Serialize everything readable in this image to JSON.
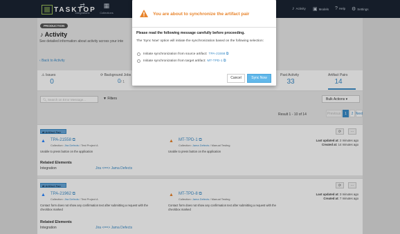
{
  "app": {
    "logo_text": "TASKTOP"
  },
  "nav": {
    "items": [
      {
        "label": "Integrations",
        "icon": "integrations-icon"
      },
      {
        "label": "Collections",
        "icon": "collections-icon"
      }
    ],
    "right": [
      {
        "label": "Activity",
        "icon": "bell-icon"
      },
      {
        "label": "Models",
        "icon": "models-icon"
      },
      {
        "label": "Help",
        "icon": "help-icon"
      },
      {
        "label": "Settings",
        "icon": "gear-icon"
      }
    ]
  },
  "page": {
    "badge": "PRODUCTION",
    "title": "Activity",
    "subtitle": "See detailed information about activity across your inte",
    "back_link": "Back to Activity"
  },
  "stats": [
    {
      "label": "Issues",
      "value": "0",
      "icon": "warning-icon"
    },
    {
      "label": "Background Jobs",
      "value": "0",
      "total": "/ 1",
      "icon": "jobs-icon"
    },
    {
      "label": "Past Activity",
      "value": "33"
    },
    {
      "label": "Artifact Pairs",
      "value": "14"
    }
  ],
  "toolbar": {
    "search_placeholder": "Search on Error Message...",
    "filters_label": "Filters",
    "bulk_actions_label": "Bulk Actions"
  },
  "pagination": {
    "result_text": "Result 1 - 10 of 14",
    "previous": "Previous",
    "page1": "1",
    "page2": "2",
    "next": "Next"
  },
  "cards": [
    {
      "tag": "Artifact Pair",
      "left": {
        "id": "TPA-21558",
        "collection_label": "Collection:",
        "collection": "Jira Defects",
        "project": "/ Test Project A",
        "desc": "Unable to press button on the application"
      },
      "right": {
        "id": "MT-TPD-1",
        "collection_label": "Collection:",
        "collection": "Jama Defects",
        "project": "/ Manual Testing",
        "desc": "Unable to press button on the application"
      },
      "updated_label": "Last updated at:",
      "updated": "2 minutes ago",
      "created_label": "Created at:",
      "created": "14 minutes ago",
      "related_title": "Related Elements",
      "integration_label": "Integration",
      "integration_value": "Jira <==> Jama Defects"
    },
    {
      "tag": "Artifact Pair",
      "left": {
        "id": "TPA-21962",
        "collection_label": "Collection:",
        "collection": "Jira Defects",
        "project": "/ Test Project A",
        "desc": "Contact form does not show any confirmation text after submitting a request with the checkbox marked"
      },
      "right": {
        "id": "MT-TPD-8",
        "collection_label": "Collection:",
        "collection": "Jama Defects",
        "project": "/ Manual Testing",
        "desc": "Contact form does not show any confirmation text after submitting a request with the checkbox marked"
      },
      "updated_label": "Last updated at:",
      "updated": "3 minutes ago",
      "created_label": "Created at:",
      "created": "7 minutes ago",
      "related_title": "Related Elements",
      "integration_label": "Integration",
      "integration_value": "Jira <==> Jama Defects"
    }
  ],
  "modal": {
    "title": "You are about to synchronize the artifact pair",
    "lead": "Please read the following message carefully before proceeding.",
    "text": "The 'Sync Now' option will initiate the synchronization based on the following selection:",
    "option1_label": "Initiate synchronization from source artifact:",
    "option1_link": "TPA-21558",
    "option2_label": "Initiate synchronization from target artifact:",
    "option2_link": "MT-TPD-1",
    "cancel_label": "Cancel",
    "sync_label": "Sync Now"
  },
  "colors": {
    "accent": "#3a8bc7",
    "warning": "#e8832a",
    "primary_button": "#62b8ea",
    "navbar": "#1a2433"
  }
}
